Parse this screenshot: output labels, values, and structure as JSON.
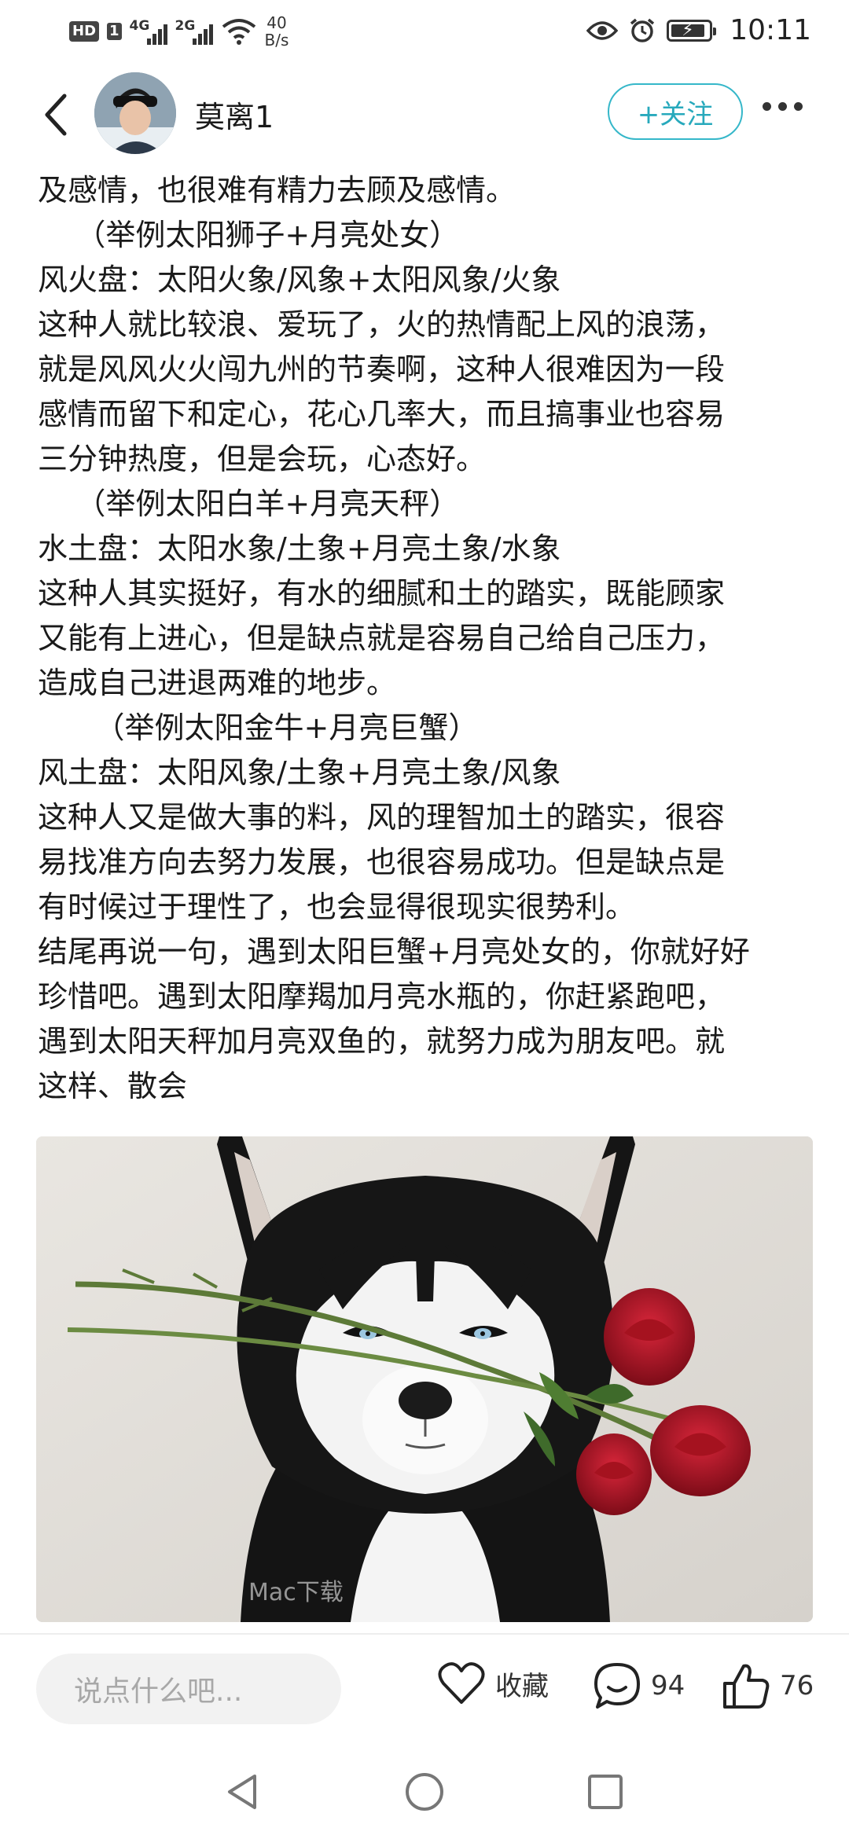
{
  "status_bar": {
    "hd_label": "HD",
    "sim1_label": "1",
    "sim1_network": "4G",
    "sim2_network": "2G",
    "net_speed_value": "40",
    "net_speed_unit": "B/s",
    "time": "10:11",
    "icons": [
      "hd-icon",
      "signal-icon",
      "signal-icon",
      "wifi-icon",
      "eye-icon",
      "alarm-icon",
      "battery-charging-icon"
    ]
  },
  "header": {
    "username": "莫离1",
    "follow_label": "+关注",
    "back_icon": "chevron-left-icon",
    "more_icon": "more-dots-icon"
  },
  "article": {
    "lines": [
      "及感情，也很难有精力去顾及感情。",
      "    （举例太阳狮子+月亮处女）",
      "风火盘：太阳火象/风象+太阳风象/火象",
      "这种人就比较浪、爱玩了，火的热情配上风的浪荡，",
      "就是风风火火闯九州的节奏啊，这种人很难因为一段",
      "感情而留下和定心，花心几率大，而且搞事业也容易",
      "三分钟热度，但是会玩，心态好。",
      "    （举例太阳白羊+月亮天秤）",
      "水土盘：太阳水象/土象+月亮土象/水象",
      "这种人其实挺好，有水的细腻和土的踏实，既能顾家",
      "又能有上进心，但是缺点就是容易自己给自己压力，",
      "造成自己进退两难的地步。",
      "      （举例太阳金牛+月亮巨蟹）",
      "风土盘：太阳风象/土象+月亮土象/风象",
      "这种人又是做大事的料，风的理智加土的踏实，很容",
      "易找准方向去努力发展，也很容易成功。但是缺点是",
      "有时候过于理性了，也会显得很现实很势利。",
      "结尾再说一句，遇到太阳巨蟹+月亮处女的，你就好好",
      "珍惜吧。遇到太阳摩羯加月亮水瓶的，你赶紧跑吧，",
      "遇到太阳天秤加月亮双鱼的，就努力成为朋友吧。就",
      "这样、散会"
    ],
    "image": {
      "subject": "husky dog holding red roses in mouth",
      "watermark": "Mac下载"
    }
  },
  "action_bar": {
    "comment_placeholder": "说点什么吧...",
    "favorite_label": "收藏",
    "favorite_icon": "heart-icon",
    "comment_count": "94",
    "comment_icon": "comment-bubble-icon",
    "like_count": "76",
    "like_icon": "thumbs-up-icon"
  },
  "nav_bar": {
    "icons": [
      "nav-back-icon",
      "nav-home-icon",
      "nav-recents-icon"
    ]
  }
}
